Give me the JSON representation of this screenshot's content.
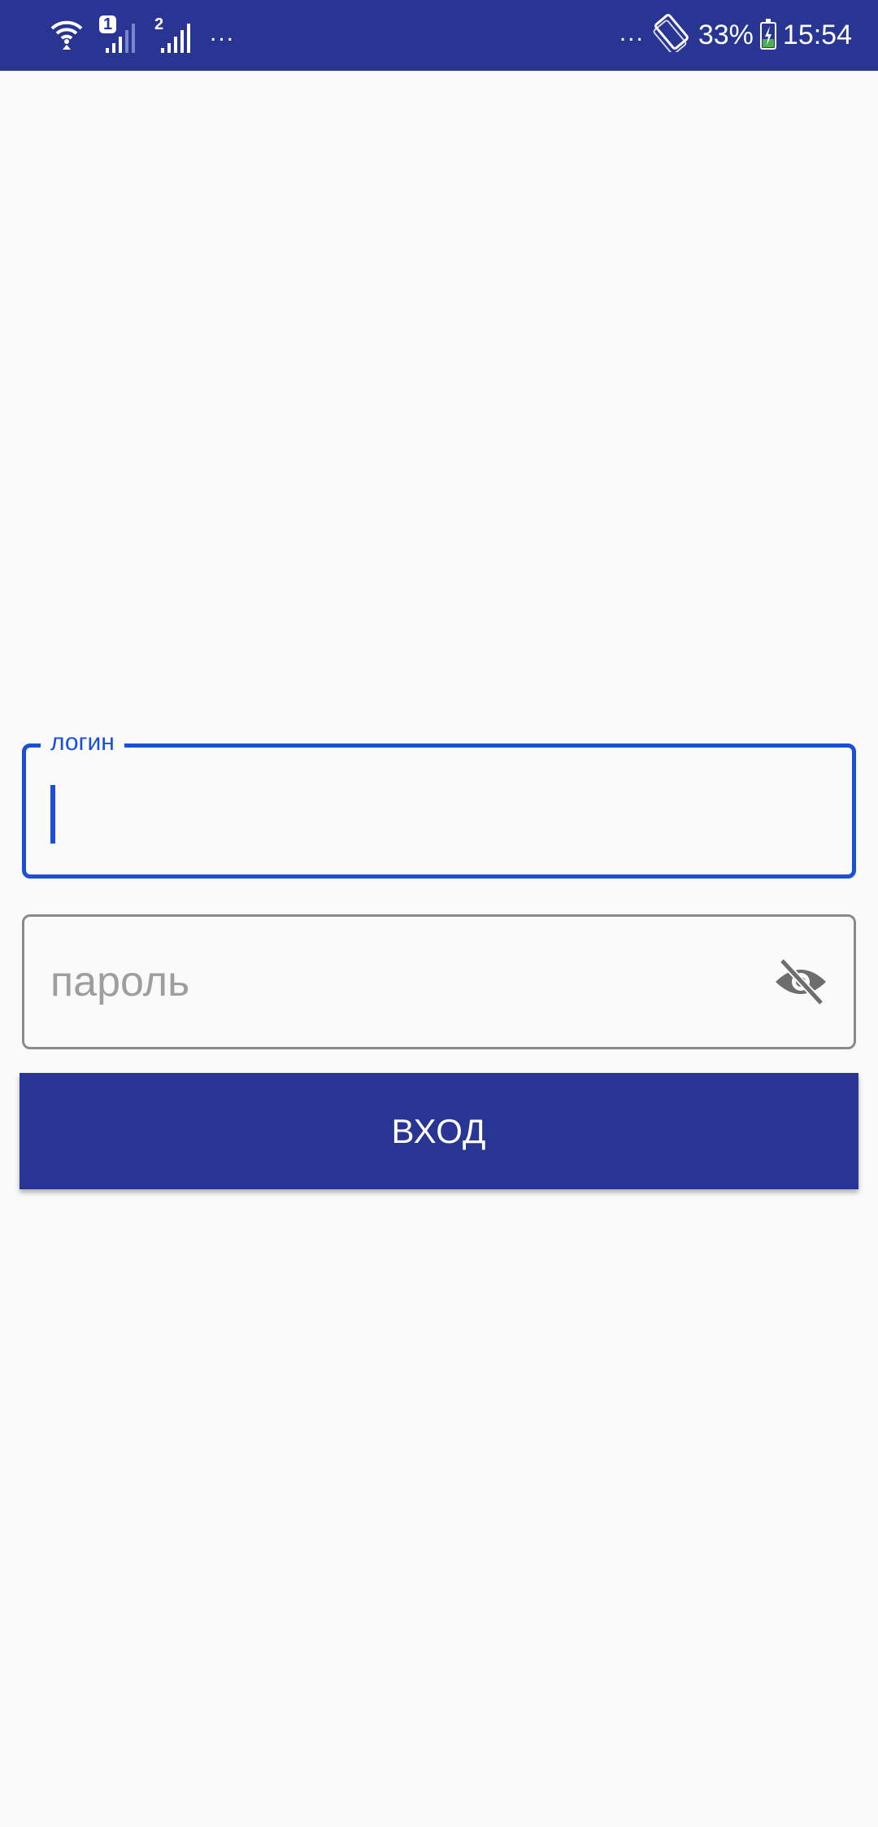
{
  "status_bar": {
    "sim1_label": "1",
    "sim2_label": "2",
    "left_overflow": "...",
    "right_overflow": "...",
    "battery_percent": "33%",
    "battery_level": 0.33,
    "time": "15:54",
    "icons": [
      "wifi-icon",
      "signal-sim1-icon",
      "signal-sim2-icon",
      "auto-rotate-icon",
      "battery-charging-icon"
    ],
    "background": "#283593"
  },
  "login_form": {
    "login_label": "логин",
    "password_placeholder": "пароль",
    "password_toggle_icon": "eye-off-icon",
    "submit_label": "ВХОД",
    "accent_color": "#1a4fd6",
    "button_color": "#283593"
  }
}
